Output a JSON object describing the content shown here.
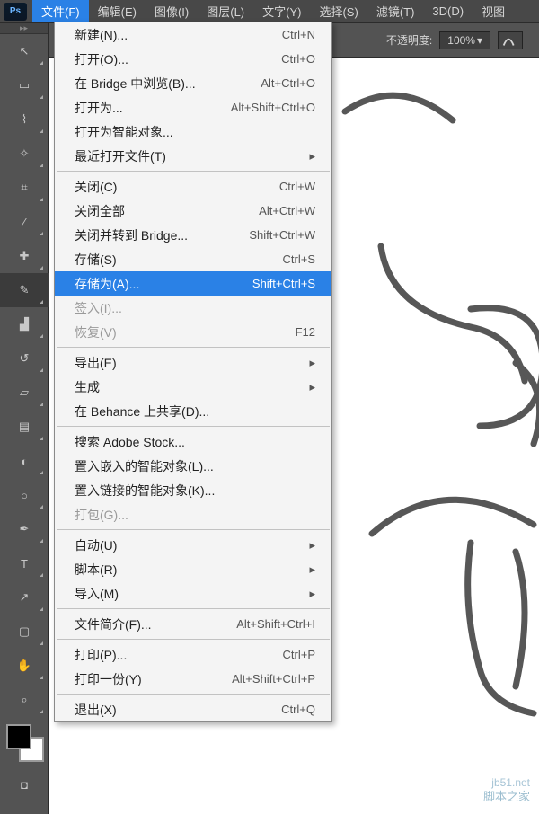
{
  "menubar": {
    "items": [
      {
        "label": "文件(F)",
        "open": true
      },
      {
        "label": "编辑(E)"
      },
      {
        "label": "图像(I)"
      },
      {
        "label": "图层(L)"
      },
      {
        "label": "文字(Y)"
      },
      {
        "label": "选择(S)"
      },
      {
        "label": "滤镜(T)"
      },
      {
        "label": "3D(D)"
      },
      {
        "label": "视图"
      }
    ]
  },
  "optionsbar": {
    "opacity_label": "不透明度:",
    "opacity_value": "100%"
  },
  "file_menu": [
    {
      "label": "新建(N)...",
      "shortcut": "Ctrl+N"
    },
    {
      "label": "打开(O)...",
      "shortcut": "Ctrl+O"
    },
    {
      "label": "在 Bridge 中浏览(B)...",
      "shortcut": "Alt+Ctrl+O"
    },
    {
      "label": "打开为...",
      "shortcut": "Alt+Shift+Ctrl+O"
    },
    {
      "label": "打开为智能对象..."
    },
    {
      "label": "最近打开文件(T)",
      "submenu": true
    },
    {
      "sep": true
    },
    {
      "label": "关闭(C)",
      "shortcut": "Ctrl+W"
    },
    {
      "label": "关闭全部",
      "shortcut": "Alt+Ctrl+W"
    },
    {
      "label": "关闭并转到 Bridge...",
      "shortcut": "Shift+Ctrl+W"
    },
    {
      "label": "存储(S)",
      "shortcut": "Ctrl+S"
    },
    {
      "label": "存储为(A)...",
      "shortcut": "Shift+Ctrl+S",
      "highlight": true
    },
    {
      "label": "签入(I)...",
      "disabled": true
    },
    {
      "label": "恢复(V)",
      "shortcut": "F12",
      "disabled": true
    },
    {
      "sep": true
    },
    {
      "label": "导出(E)",
      "submenu": true
    },
    {
      "label": "生成",
      "submenu": true
    },
    {
      "label": "在 Behance 上共享(D)..."
    },
    {
      "sep": true
    },
    {
      "label": "搜索 Adobe Stock..."
    },
    {
      "label": "置入嵌入的智能对象(L)..."
    },
    {
      "label": "置入链接的智能对象(K)..."
    },
    {
      "label": "打包(G)...",
      "disabled": true
    },
    {
      "sep": true
    },
    {
      "label": "自动(U)",
      "submenu": true
    },
    {
      "label": "脚本(R)",
      "submenu": true
    },
    {
      "label": "导入(M)",
      "submenu": true
    },
    {
      "sep": true
    },
    {
      "label": "文件简介(F)...",
      "shortcut": "Alt+Shift+Ctrl+I"
    },
    {
      "sep": true
    },
    {
      "label": "打印(P)...",
      "shortcut": "Ctrl+P"
    },
    {
      "label": "打印一份(Y)",
      "shortcut": "Alt+Shift+Ctrl+P"
    },
    {
      "sep": true
    },
    {
      "label": "退出(X)",
      "shortcut": "Ctrl+Q"
    }
  ],
  "tools": [
    {
      "name": "move-tool",
      "glyph": "↖"
    },
    {
      "name": "marquee-tool",
      "glyph": "▭"
    },
    {
      "name": "lasso-tool",
      "glyph": "⌇"
    },
    {
      "name": "magic-wand-tool",
      "glyph": "✧"
    },
    {
      "name": "crop-tool",
      "glyph": "⌗"
    },
    {
      "name": "eyedropper-tool",
      "glyph": "⁄"
    },
    {
      "name": "healing-brush-tool",
      "glyph": "✚"
    },
    {
      "name": "brush-tool",
      "glyph": "✎",
      "selected": true
    },
    {
      "name": "clone-stamp-tool",
      "glyph": "▟"
    },
    {
      "name": "history-brush-tool",
      "glyph": "↺"
    },
    {
      "name": "eraser-tool",
      "glyph": "▱"
    },
    {
      "name": "gradient-tool",
      "glyph": "▤"
    },
    {
      "name": "blur-tool",
      "glyph": "◐"
    },
    {
      "name": "dodge-tool",
      "glyph": "○"
    },
    {
      "name": "pen-tool",
      "glyph": "✒"
    },
    {
      "name": "type-tool",
      "glyph": "T"
    },
    {
      "name": "path-selection-tool",
      "glyph": "↗"
    },
    {
      "name": "rectangle-tool",
      "glyph": "▢"
    },
    {
      "name": "hand-tool",
      "glyph": "✋"
    },
    {
      "name": "zoom-tool",
      "glyph": "⌕"
    }
  ],
  "watermark": {
    "domain": "jb51.net",
    "name": "脚本之家"
  },
  "ps_logo": "Ps"
}
